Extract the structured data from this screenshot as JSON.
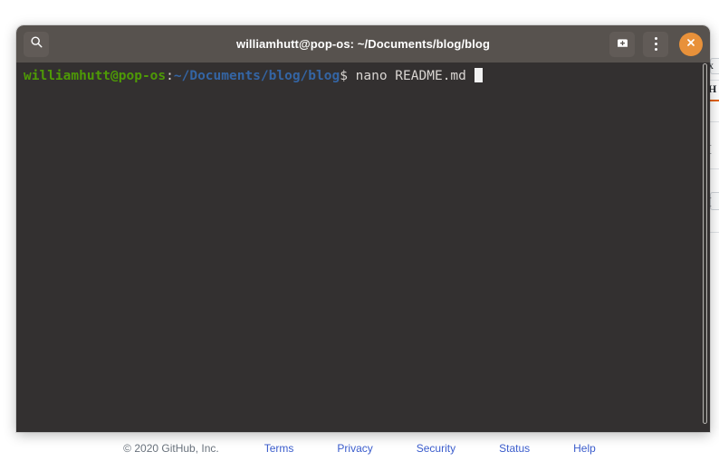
{
  "window": {
    "title": "williamhutt@pop-os: ~/Documents/blog/blog",
    "search_icon": "search-icon",
    "new_tab_icon": "new-tab-icon",
    "menu_icon": "vertical-dots-menu-icon",
    "close_icon": "close-icon",
    "titlebar_color": "#57524e",
    "close_button_color": "#e8913a"
  },
  "terminal": {
    "background_color": "#333030",
    "prompt": {
      "user_host": "williamhutt@pop-os",
      "separator": ":",
      "path": "~/Documents/blog/blog",
      "command": "$ nano README.md ",
      "user_host_color": "#4e9a06",
      "path_color": "#3465a4",
      "text_color": "#d9d5d2"
    },
    "cursor": "block-cursor"
  },
  "footer": {
    "copyright": "© 2020 GitHub, Inc.",
    "link_color": "#3a5ccc",
    "links": [
      {
        "label": "Terms"
      },
      {
        "label": "Privacy"
      },
      {
        "label": "Security"
      },
      {
        "label": "Status"
      },
      {
        "label": "Help"
      }
    ]
  },
  "background_page": {
    "glyphs": [
      "x",
      "H",
      "[",
      "["
    ]
  }
}
